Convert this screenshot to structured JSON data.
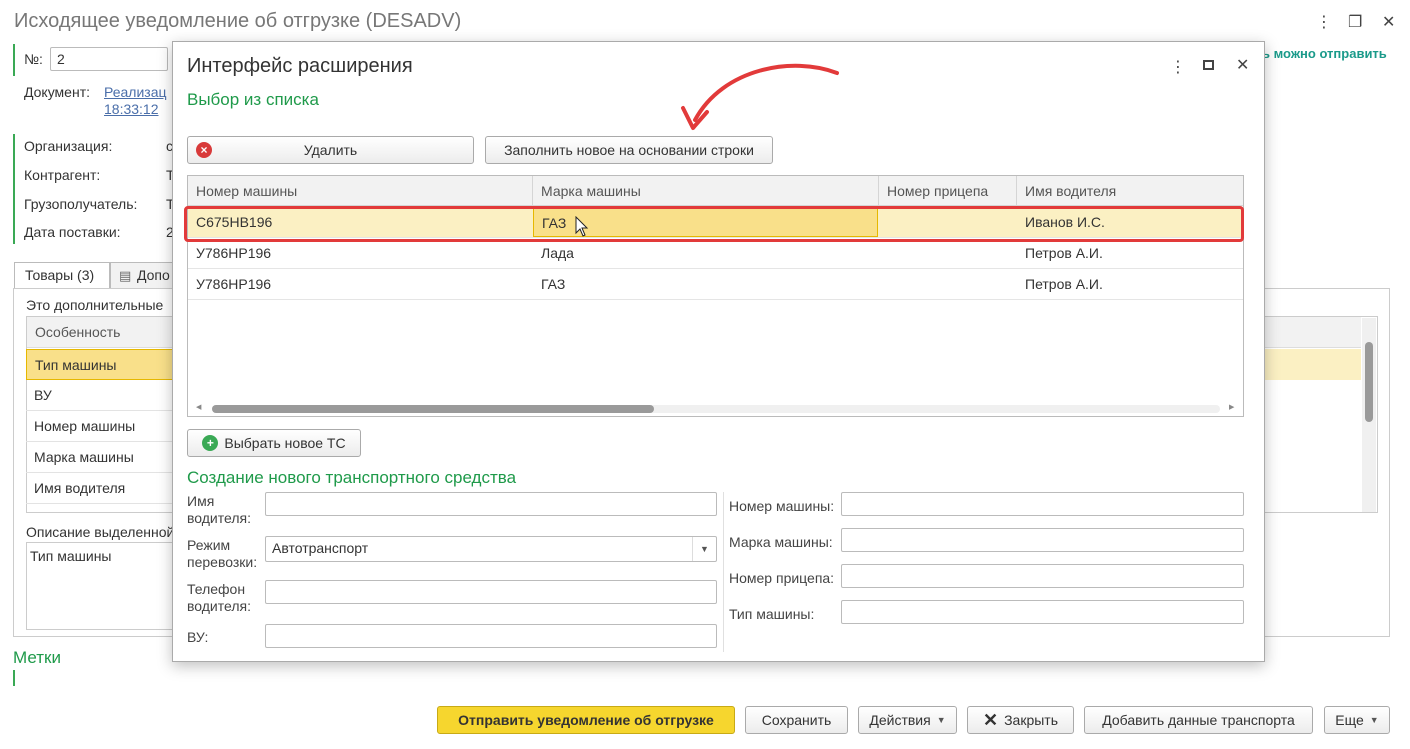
{
  "window": {
    "title": "Исходящее уведомление об отгрузке (DESADV)",
    "more_icon": "⋮",
    "restore_icon": "❐",
    "close_icon": "✕",
    "send_hint": "ь можно отправить"
  },
  "header": {
    "number_label": "№:",
    "number_value": "2",
    "document_label": "Документ:",
    "document_link": "Реализац",
    "document_time": "18:33:12"
  },
  "fields": {
    "org_label": "Организация:",
    "org_value": "c",
    "contractor_label": "Контрагент:",
    "contractor_value": "T",
    "consignee_label": "Грузополучатель:",
    "consignee_value": "T",
    "delivery_label": "Дата поставки:",
    "delivery_value": "2"
  },
  "tabs": {
    "goods": "Товары (3)",
    "extra": "Допо"
  },
  "extra_panel": {
    "note": "Это дополнительные",
    "column_header": "Особенность",
    "rows": [
      "Тип машины",
      "ВУ",
      "Номер машины",
      "Марка машины",
      "Имя водителя"
    ],
    "description_label": "Описание выделенной",
    "description_value": "Тип машины"
  },
  "tags_title": "Метки",
  "footer": {
    "send": "Отправить уведомление об отгрузке",
    "save": "Сохранить",
    "actions": "Действия",
    "close": "Закрыть",
    "add_transport": "Добавить данные транспорта",
    "more": "Еще"
  },
  "dialog": {
    "title": "Интерфейс расширения",
    "subtitle": "Выбор из списка",
    "delete_button": "Удалить",
    "fill_button": "Заполнить новое на основании строки",
    "table": {
      "columns": [
        "Номер машины",
        "Марка машины",
        "Номер прицепа",
        "Имя водителя"
      ],
      "rows": [
        [
          "С675НВ196",
          "ГАЗ",
          "",
          "Иванов И.С."
        ],
        [
          "У786НР196",
          "Лада",
          "",
          "Петров А.И."
        ],
        [
          "У786НР196",
          "ГАЗ",
          "",
          "Петров А.И."
        ]
      ]
    },
    "select_new_button": "Выбрать новое ТС",
    "new_section_title": "Создание нового транспортного средства",
    "form": {
      "driver_name_label_1": "Имя",
      "driver_name_label_2": "водителя:",
      "mode_label_1": "Режим",
      "mode_label_2": "перевозки:",
      "mode_value": "Автотранспорт",
      "phone_label_1": "Телефон",
      "phone_label_2": "водителя:",
      "license_label": "ВУ:",
      "car_number_label": "Номер машины:",
      "car_brand_label": "Марка машины:",
      "trailer_label": "Номер прицепа:",
      "car_type_label": "Тип машины:"
    }
  },
  "colors": {
    "accent_green": "#1f9a4a",
    "highlight_red": "#e23a3a",
    "primary_button": "#f6d62e",
    "selected_row": "#fbf0c3"
  }
}
